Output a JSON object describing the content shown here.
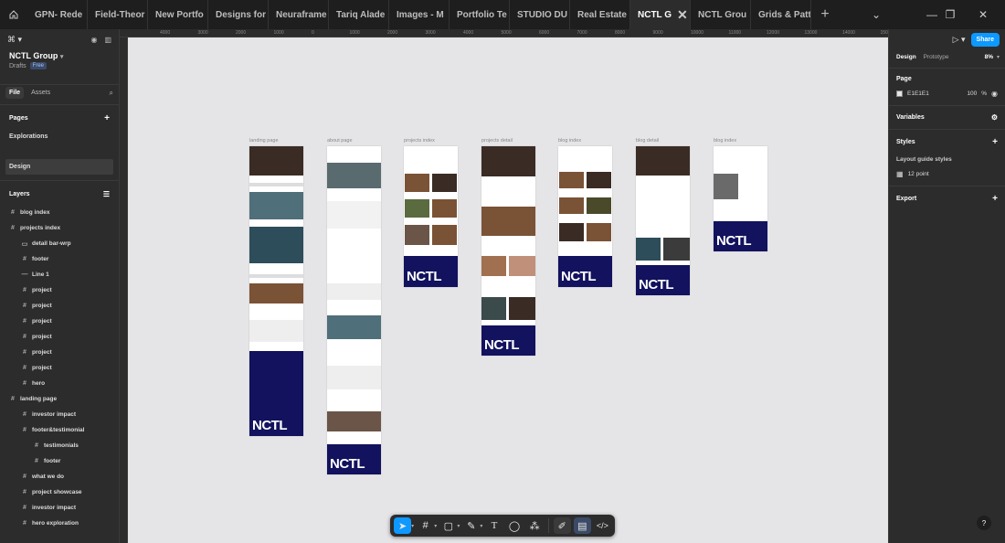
{
  "tabs": [
    {
      "label": "GPN- Rede"
    },
    {
      "label": "Field-Theor"
    },
    {
      "label": "New Portfo"
    },
    {
      "label": "Designs for"
    },
    {
      "label": "Neuraframe"
    },
    {
      "label": "Tariq Alade"
    },
    {
      "label": "Images - M"
    },
    {
      "label": "Portfolio Te"
    },
    {
      "label": "STUDIO DU"
    },
    {
      "label": "Real Estate"
    },
    {
      "label": "NCTL G",
      "active": true
    },
    {
      "label": "NCTL Grou"
    },
    {
      "label": "Grids & Patt"
    }
  ],
  "project": {
    "name": "NCTL Group",
    "location": "Drafts",
    "plan": "Free"
  },
  "left_tabs": {
    "file": "File",
    "assets": "Assets"
  },
  "pages_section": {
    "title": "Pages",
    "items": [
      "Explorations",
      "Design"
    ]
  },
  "layers_section": {
    "title": "Layers",
    "items": [
      {
        "label": "blog index",
        "indent": 0,
        "icon": "#"
      },
      {
        "label": "projects index",
        "indent": 0,
        "icon": "#"
      },
      {
        "label": "detail bar-wrp",
        "indent": 1,
        "icon": "▭"
      },
      {
        "label": "footer",
        "indent": 1,
        "icon": "#"
      },
      {
        "label": "Line 1",
        "indent": 1,
        "icon": "—"
      },
      {
        "label": "project",
        "indent": 1,
        "icon": "#"
      },
      {
        "label": "project",
        "indent": 1,
        "icon": "#"
      },
      {
        "label": "project",
        "indent": 1,
        "icon": "#"
      },
      {
        "label": "project",
        "indent": 1,
        "icon": "#"
      },
      {
        "label": "project",
        "indent": 1,
        "icon": "#"
      },
      {
        "label": "project",
        "indent": 1,
        "icon": "#"
      },
      {
        "label": "hero",
        "indent": 1,
        "icon": "#"
      },
      {
        "label": "landing page",
        "indent": 0,
        "icon": "#"
      },
      {
        "label": "investor impact",
        "indent": 1,
        "icon": "#"
      },
      {
        "label": "footer&testimonial",
        "indent": 1,
        "icon": "#"
      },
      {
        "label": "testimonials",
        "indent": 2,
        "icon": "#"
      },
      {
        "label": "footer",
        "indent": 2,
        "icon": "#"
      },
      {
        "label": "what we do",
        "indent": 1,
        "icon": "#"
      },
      {
        "label": "project showcase",
        "indent": 1,
        "icon": "#"
      },
      {
        "label": "investor impact",
        "indent": 1,
        "icon": "#"
      },
      {
        "label": "hero exploration",
        "indent": 1,
        "icon": "#"
      }
    ]
  },
  "ruler_ticks": [
    "4000",
    "3000",
    "2000",
    "1000",
    "0",
    "1000",
    "2000",
    "3000",
    "4000",
    "5000",
    "6000",
    "7000",
    "8000",
    "9000",
    "10000",
    "11000",
    "12000",
    "13000",
    "14000",
    "15000"
  ],
  "frames": [
    {
      "label": "landing page"
    },
    {
      "label": "about page"
    },
    {
      "label": "projects index"
    },
    {
      "label": "projects detail"
    },
    {
      "label": "blog index"
    },
    {
      "label": "blog detail"
    },
    {
      "label": "blog index"
    }
  ],
  "footer_logo": "NCTL",
  "right_panel": {
    "share": "Share",
    "tab_design": "Design",
    "tab_prototype": "Prototype",
    "zoom": "8%",
    "page_title": "Page",
    "page_color": "E1E1E1",
    "page_opacity": "100",
    "page_opacity_unit": "%",
    "variables": "Variables",
    "styles": "Styles",
    "layout_guide_styles": "Layout guide styles",
    "grid_style": "12 point",
    "export": "Export"
  },
  "colors": {
    "accent": "#0d99ff",
    "canvas": "#e5e4e7",
    "navy": "#12125e"
  },
  "help": "?"
}
